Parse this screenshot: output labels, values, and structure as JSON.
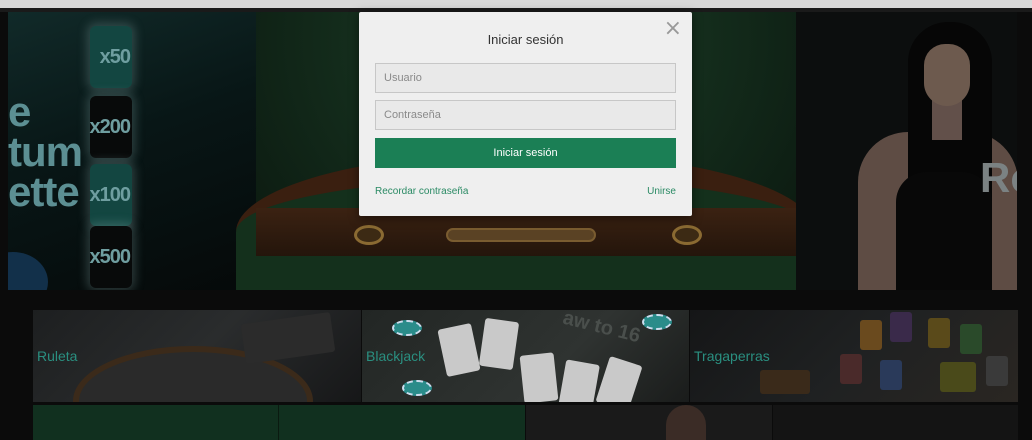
{
  "hero": {
    "left_title_lines": [
      "e",
      "tum",
      "ette"
    ],
    "multipliers": [
      "x50",
      "x200",
      "x100",
      "x500"
    ],
    "right_title": "Ro"
  },
  "categories": [
    {
      "label": "Ruleta"
    },
    {
      "label": "Blackjack"
    },
    {
      "label": "Tragaperras"
    }
  ],
  "tile_overlay_text": "aw to 16",
  "modal": {
    "title": "Iniciar sesión",
    "close_symbol": "×",
    "username_placeholder": "Usuario",
    "password_placeholder": "Contraseña",
    "submit_label": "Iniciar sesión",
    "forgot_password_label": "Recordar contraseña",
    "join_label": "Unirse"
  },
  "colors": {
    "primary_button": "#1b7f55",
    "link": "#2a8a64",
    "category_label": "#2a8f80"
  }
}
